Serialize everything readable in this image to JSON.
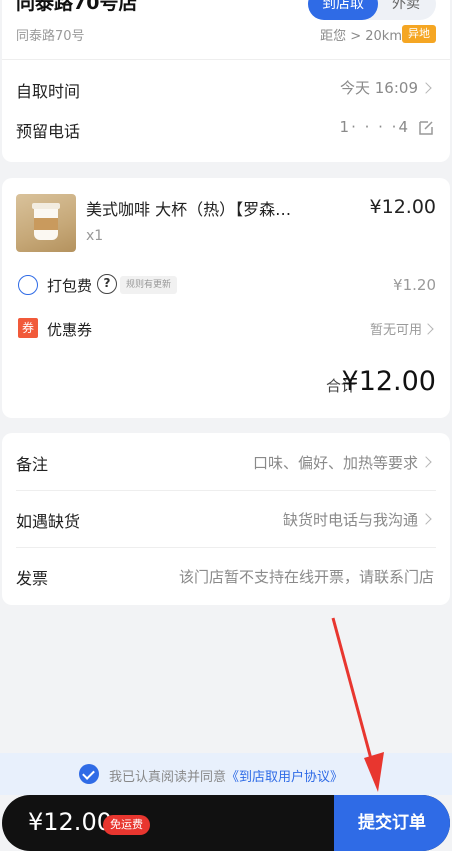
{
  "store": {
    "name": "同泰路70号店",
    "mode_active": "到店取",
    "mode_other": "外卖",
    "address": "同泰路70号",
    "distance": "距您 > 20km",
    "badge": "异地"
  },
  "pickup": {
    "time_label": "自取时间",
    "time_value": "今天 16:09",
    "phone_label": "预留电话",
    "phone_value": "1·   ·  · ·4"
  },
  "order": {
    "product_name": "美式咖啡 大杯（热）【罗森…",
    "product_qty": "x1",
    "product_price": "¥12.00",
    "packaging_label": "打包费",
    "help_glyph": "?",
    "rule_tag": "规则有更新",
    "packaging_fee": "¥1.20",
    "coupon_icon_text": "券",
    "coupon_label": "优惠券",
    "coupon_value": "暂无可用",
    "total_label": "合计",
    "total_value": "¥12.00"
  },
  "notes": {
    "remark_label": "备注",
    "remark_value": "口味、偏好、加热等要求",
    "stockout_label": "如遇缺货",
    "stockout_value": "缺货时电话与我沟通",
    "invoice_label": "发票",
    "invoice_value": "该门店暂不支持在线开票，请联系门店"
  },
  "agreement": {
    "text": "我已认真阅读并同意",
    "link": "《到店取用户协议》"
  },
  "bottom_bar": {
    "price": "¥12.00",
    "badge": "免运费",
    "submit": "提交订单"
  },
  "colors": {
    "accent": "#2f6be6",
    "badge_orange": "#f5a623",
    "coupon_red": "#f15a3a",
    "annotation_red": "#e8362f"
  }
}
